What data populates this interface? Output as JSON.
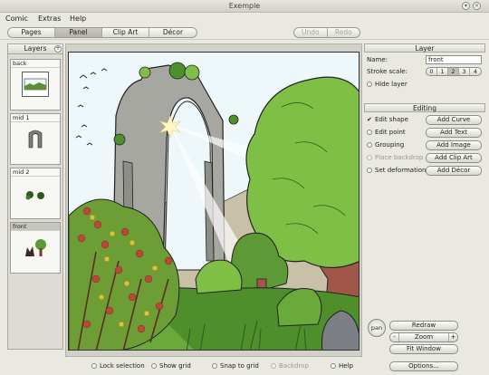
{
  "window": {
    "title": "Exemple"
  },
  "menu": [
    "Comic",
    "Extras",
    "Help"
  ],
  "toolbar": {
    "tabs": [
      "Pages",
      "Panel",
      "Clip Art",
      "Décor"
    ],
    "undo": "Undo",
    "redo": "Redo"
  },
  "layers": {
    "header": "Layers",
    "add_symbol": "+",
    "items": [
      {
        "label": "back"
      },
      {
        "label": "mid 1"
      },
      {
        "label": "mid 2"
      },
      {
        "label": "front"
      }
    ]
  },
  "layer_panel": {
    "header": "Layer",
    "name_label": "Name:",
    "name_value": "front",
    "stroke_label": "Stroke scale:",
    "stroke_options": [
      "0",
      "1",
      "2",
      "3",
      "4"
    ],
    "stroke_selected": "2",
    "hide_label": "Hide layer"
  },
  "editing": {
    "header": "Editing",
    "modes": [
      {
        "label": "Edit shape",
        "selected": true,
        "enabled": true
      },
      {
        "label": "Edit point",
        "selected": false,
        "enabled": true
      },
      {
        "label": "Grouping",
        "selected": false,
        "enabled": true
      },
      {
        "label": "Place backdrop",
        "selected": false,
        "enabled": false
      },
      {
        "label": "Set deformation",
        "selected": false,
        "enabled": true
      }
    ],
    "buttons": [
      "Add Curve",
      "Add Text",
      "Add Image",
      "Add Clip Art",
      "Add Décor"
    ]
  },
  "view": {
    "pan": "pan",
    "redraw": "Redraw",
    "zoom_minus": "-",
    "zoom": "Zoom",
    "zoom_plus": "+",
    "fit": "Fit Window"
  },
  "status": {
    "lock": "Lock selection",
    "grid": "Show grid",
    "snap": "Snap to grid",
    "backdrop": "Backdrop",
    "help": "Help",
    "options": "Options..."
  },
  "colors": {
    "sky": "#eef8fb",
    "stone": "#a7a7a2",
    "foliage": "#7fbf45",
    "dark_foliage": "#4e8f2b",
    "trunk": "#a0574a",
    "flowers": "#b84a3a"
  }
}
